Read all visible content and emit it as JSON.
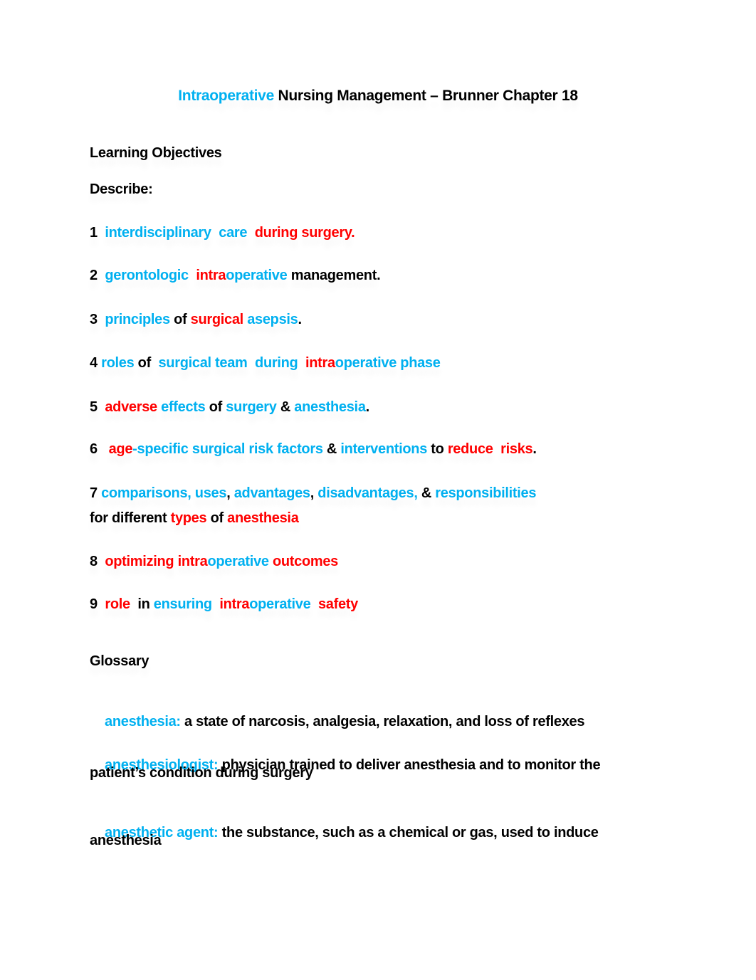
{
  "colors": {
    "blue": "#00B0F0",
    "red": "#FF0000",
    "black": "#000000"
  },
  "title": [
    {
      "t": "Intraoperative",
      "c": "blue"
    },
    {
      "t": " Nursing Management – Brunner Chapter 18",
      "c": "blk"
    }
  ],
  "learning_objectives_heading": "Learning Objectives",
  "describe_label": "Describe:",
  "objectives": [
    [
      {
        "t": "1  ",
        "c": "blk"
      },
      {
        "t": "interdisciplinary  care",
        "c": "blue"
      },
      {
        "t": "  ",
        "c": "blk"
      },
      {
        "t": "during surgery.",
        "c": "red"
      }
    ],
    [
      {
        "t": "2  ",
        "c": "blk"
      },
      {
        "t": "gerontologic",
        "c": "blue"
      },
      {
        "t": "  ",
        "c": "blk"
      },
      {
        "t": "intra",
        "c": "red"
      },
      {
        "t": "operative",
        "c": "blue"
      },
      {
        "t": " management.",
        "c": "blk"
      }
    ],
    [
      {
        "t": "3  ",
        "c": "blk"
      },
      {
        "t": "principles",
        "c": "blue"
      },
      {
        "t": " of ",
        "c": "blk"
      },
      {
        "t": "surgical",
        "c": "red"
      },
      {
        "t": " asepsis",
        "c": "blue"
      },
      {
        "t": ".",
        "c": "blk"
      }
    ],
    [
      {
        "t": "4 ",
        "c": "blk"
      },
      {
        "t": "roles",
        "c": "blue"
      },
      {
        "t": " of  ",
        "c": "blk"
      },
      {
        "t": "surgical team  during",
        "c": "blue"
      },
      {
        "t": "  ",
        "c": "blk"
      },
      {
        "t": "intra",
        "c": "red"
      },
      {
        "t": "operative phase",
        "c": "blue"
      }
    ],
    [
      {
        "t": "5  ",
        "c": "blk"
      },
      {
        "t": "adverse",
        "c": "red"
      },
      {
        "t": " effects",
        "c": "blue"
      },
      {
        "t": " of ",
        "c": "blk"
      },
      {
        "t": "surgery",
        "c": "blue"
      },
      {
        "t": " & ",
        "c": "blk"
      },
      {
        "t": "anesthesia",
        "c": "blue"
      },
      {
        "t": ".",
        "c": "blk"
      }
    ],
    [
      {
        "t": "6   ",
        "c": "blk"
      },
      {
        "t": "age",
        "c": "red"
      },
      {
        "t": "-specific surgical risk factors",
        "c": "blue"
      },
      {
        "t": " & ",
        "c": "blk"
      },
      {
        "t": "interventions",
        "c": "blue"
      },
      {
        "t": " to ",
        "c": "blk"
      },
      {
        "t": "reduce  risks",
        "c": "red"
      },
      {
        "t": ".",
        "c": "blk"
      }
    ],
    [
      {
        "t": "7 ",
        "c": "blk"
      },
      {
        "t": "comparisons, uses",
        "c": "blue"
      },
      {
        "t": ", ",
        "c": "blk"
      },
      {
        "t": "advantages",
        "c": "blue"
      },
      {
        "t": ", ",
        "c": "blk"
      },
      {
        "t": "disadvantages,",
        "c": "blue"
      },
      {
        "t": " & ",
        "c": "blk"
      },
      {
        "t": "responsibilities",
        "c": "blue"
      }
    ],
    [
      {
        "t": "for different ",
        "c": "blk"
      },
      {
        "t": "types",
        "c": "red"
      },
      {
        "t": " of ",
        "c": "blk"
      },
      {
        "t": "anesthesia",
        "c": "red"
      }
    ],
    [
      {
        "t": "8  ",
        "c": "blk"
      },
      {
        "t": "optimizing",
        "c": "red"
      },
      {
        "t": " intra",
        "c": "red"
      },
      {
        "t": "operative",
        "c": "blue"
      },
      {
        "t": " ",
        "c": "blk"
      },
      {
        "t": "outcomes",
        "c": "red"
      }
    ],
    [
      {
        "t": "9  ",
        "c": "blk"
      },
      {
        "t": "role",
        "c": "red"
      },
      {
        "t": "  in ",
        "c": "blk"
      },
      {
        "t": "ensuring",
        "c": "blue"
      },
      {
        "t": "  ",
        "c": "blk"
      },
      {
        "t": "intra",
        "c": "red"
      },
      {
        "t": "operative",
        "c": "blue"
      },
      {
        "t": "  ",
        "c": "blk"
      },
      {
        "t": "safety",
        "c": "red"
      }
    ]
  ],
  "glossary_heading": "Glossary",
  "glossary": [
    {
      "term": "anesthesia:",
      "lines": [
        " a state of narcosis, analgesia, relaxation, and loss of reflexes"
      ]
    },
    {
      "term": "anesthesiologist:",
      "lines": [
        " physician trained to deliver anesthesia and to monitor the",
        "patient’s condition during surgery"
      ]
    },
    {
      "term": "anesthetic agent:",
      "lines": [
        " the substance, such as a chemical or gas, used to induce",
        "anesthesia"
      ]
    }
  ]
}
